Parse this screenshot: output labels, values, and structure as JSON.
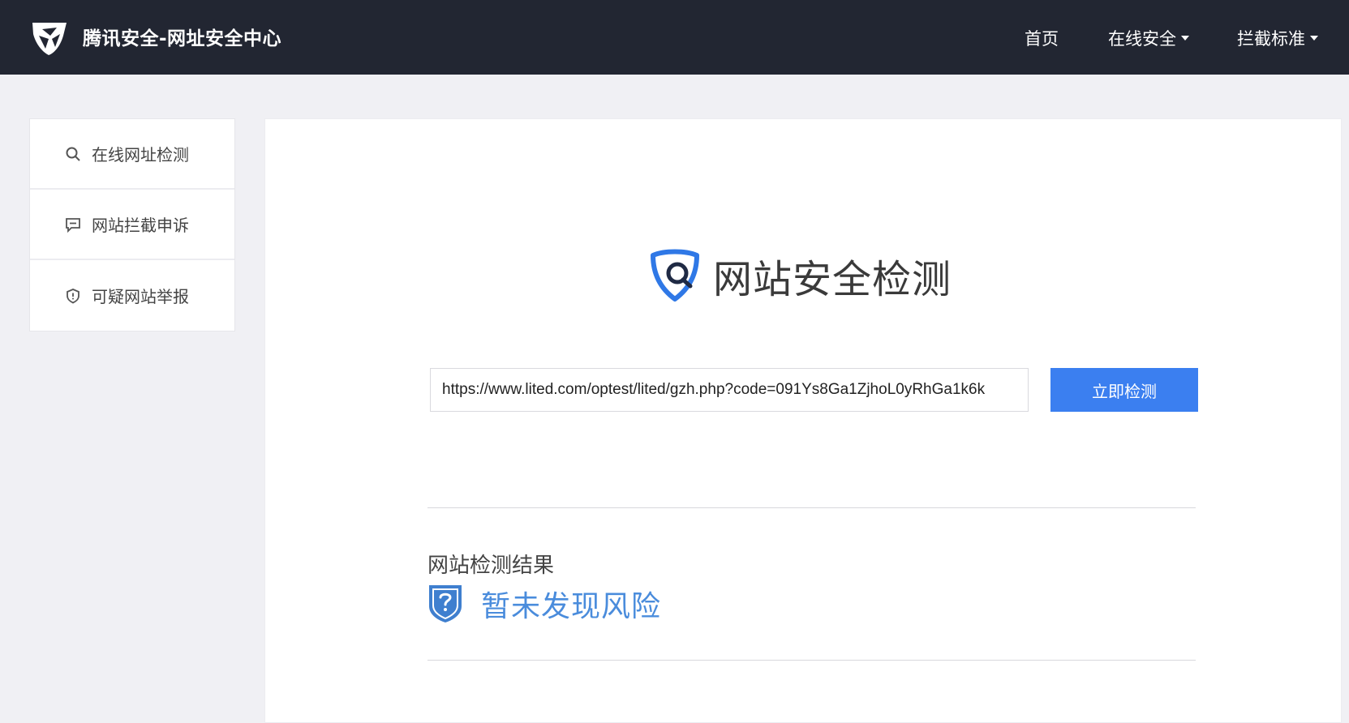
{
  "header": {
    "brand_title": "腾讯安全-网址安全中心",
    "nav": [
      {
        "label": "首页",
        "has_dropdown": false
      },
      {
        "label": "在线安全",
        "has_dropdown": true
      },
      {
        "label": "拦截标准",
        "has_dropdown": true
      }
    ],
    "background_color": "#222632"
  },
  "sidebar": {
    "items": [
      {
        "label": "在线网址检测",
        "icon": "search-icon"
      },
      {
        "label": "网站拦截申诉",
        "icon": "chat-icon"
      },
      {
        "label": "可疑网站举报",
        "icon": "shield-alert-icon"
      }
    ]
  },
  "main": {
    "hero_title": "网站安全检测",
    "url_input_value": "https://www.lited.com/optest/lited/gzh.php?code=091Ys8Ga1ZjhoL0yRhGa1k6k",
    "detect_button_label": "立即检测",
    "result_heading": "网站检测结果",
    "result_status": "暂未发现风险",
    "accent_color": "#3b7ff0",
    "status_color": "#4a8cdc"
  }
}
